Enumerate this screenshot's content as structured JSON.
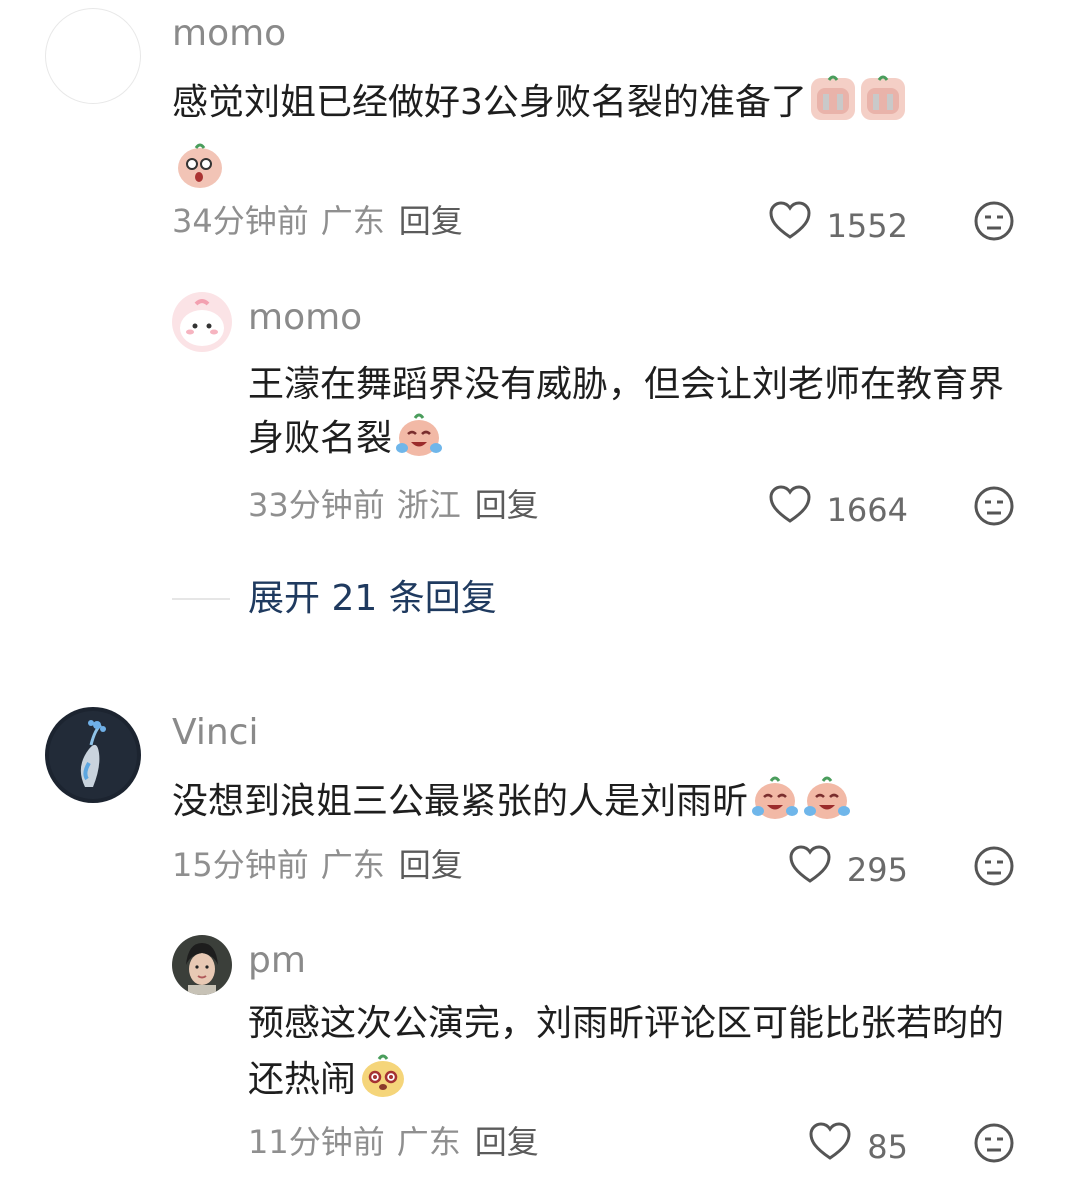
{
  "comments": [
    {
      "username": "momo",
      "text": "感觉刘姐已经做好3公身败名裂的准备了",
      "emojis": [
        "crying-sticker-icon",
        "crying-sticker-icon",
        "shocked-sticker-icon"
      ],
      "time": "34分钟前",
      "location": "广东",
      "reply_label": "回复",
      "likes": "1552",
      "reply": {
        "username": "momo",
        "text": "王濛在舞蹈界没有威胁，但会让刘老师在教育界身败名裂",
        "emojis": [
          "laughing-crying-emoji-icon"
        ],
        "time": "33分钟前",
        "location": "浙江",
        "reply_label": "回复",
        "likes": "1664"
      },
      "expand_label": "展开 21 条回复"
    },
    {
      "username": "Vinci",
      "text": "没想到浪姐三公最紧张的人是刘雨昕",
      "emojis": [
        "laughing-crying-emoji-icon",
        "laughing-crying-emoji-icon"
      ],
      "time": "15分钟前",
      "location": "广东",
      "reply_label": "回复",
      "likes": "295",
      "reply": {
        "username": "pm",
        "text": "预感这次公演完，刘雨昕评论区可能比张若昀的还热闹",
        "emojis": [
          "smug-emoji-icon"
        ],
        "time": "11分钟前",
        "location": "广东",
        "reply_label": "回复",
        "likes": "85"
      }
    }
  ],
  "colors": {
    "meta": "#8f8f8f",
    "username": "#8a8a8a",
    "expand": "#1f3a5f"
  }
}
